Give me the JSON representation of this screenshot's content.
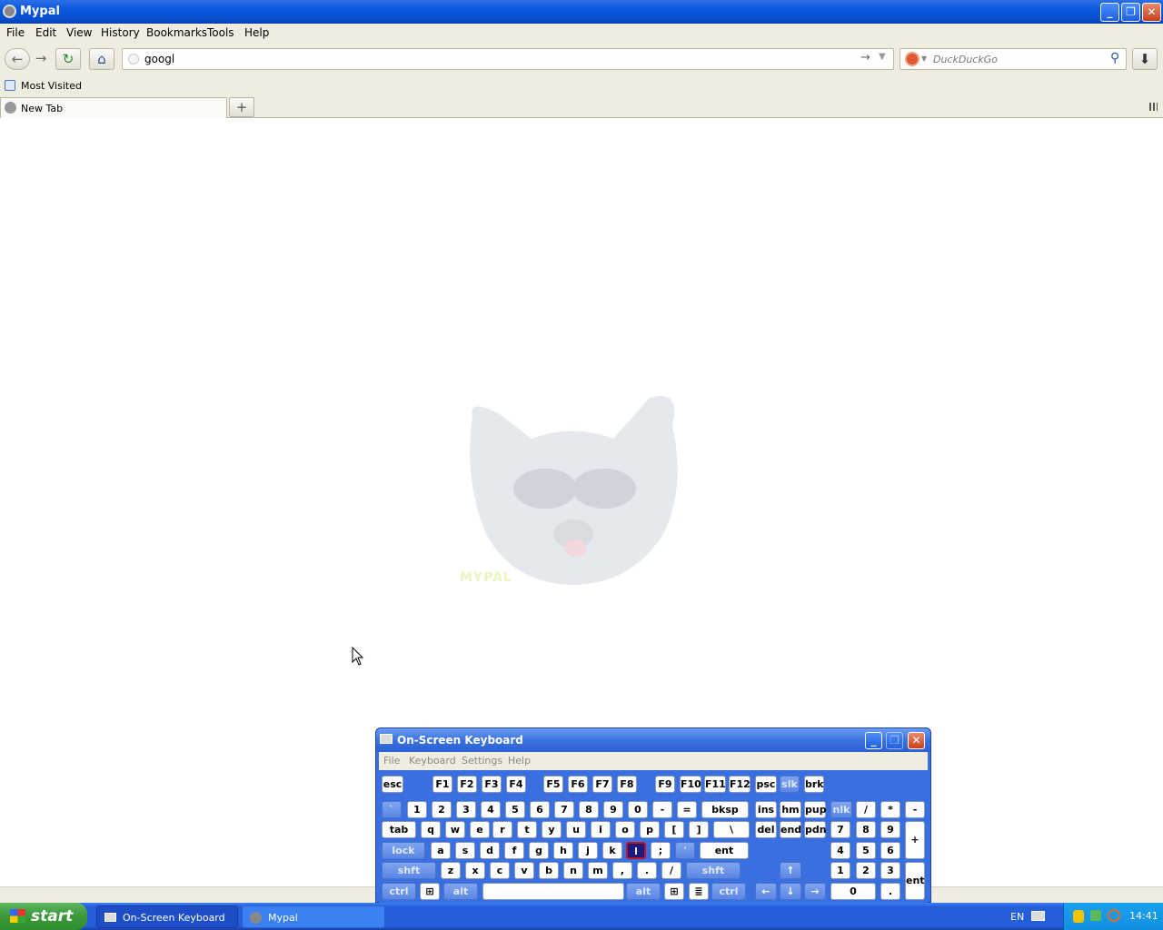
{
  "window": {
    "title": "Mypal"
  },
  "menubar": {
    "items": [
      "File",
      "Edit",
      "View",
      "History",
      "Bookmarks",
      "Tools",
      "Help"
    ]
  },
  "navbar": {
    "url_value": "googl",
    "search_placeholder": "DuckDuckGo"
  },
  "bookmarks": {
    "items": [
      "Most Visited"
    ]
  },
  "tabs": [
    {
      "label": "New Tab"
    }
  ],
  "osk": {
    "title": "On-Screen Keyboard",
    "menu": [
      "File",
      "Keyboard",
      "Settings",
      "Help"
    ],
    "rows": {
      "fn": [
        "esc",
        "F1",
        "F2",
        "F3",
        "F4",
        "F5",
        "F6",
        "F7",
        "F8",
        "F9",
        "F10",
        "F11",
        "F12",
        "psc",
        "slk",
        "brk"
      ],
      "num": [
        "`",
        "1",
        "2",
        "3",
        "4",
        "5",
        "6",
        "7",
        "8",
        "9",
        "0",
        "-",
        "=",
        "bksp",
        "ins",
        "hm",
        "pup",
        "nlk",
        "/",
        "*",
        "-"
      ],
      "tab": [
        "tab",
        "q",
        "w",
        "e",
        "r",
        "t",
        "y",
        "u",
        "i",
        "o",
        "p",
        "[",
        "]",
        "\\",
        "del",
        "end",
        "pdn",
        "7",
        "8",
        "9",
        "+"
      ],
      "caps": [
        "lock",
        "a",
        "s",
        "d",
        "f",
        "g",
        "h",
        "j",
        "k",
        "l",
        ";",
        "'",
        "ent",
        "4",
        "5",
        "6"
      ],
      "shift": [
        "shft",
        "z",
        "x",
        "c",
        "v",
        "b",
        "n",
        "m",
        ",",
        ".",
        "/",
        "shft",
        "1",
        "2",
        "3",
        "ent"
      ],
      "ctrl": [
        "ctrl",
        "alt",
        "alt",
        "ctrl",
        "0",
        "."
      ]
    },
    "selected_key": "l"
  },
  "taskbar": {
    "start": "start",
    "tasks": [
      "On-Screen Keyboard",
      "Mypal"
    ],
    "lang": "EN",
    "clock": "14:41"
  },
  "colors": {
    "titlebar": "#0a58dc",
    "taskbar": "#245edb",
    "start": "#3c9a3c",
    "osk": "#3a6fe0"
  }
}
